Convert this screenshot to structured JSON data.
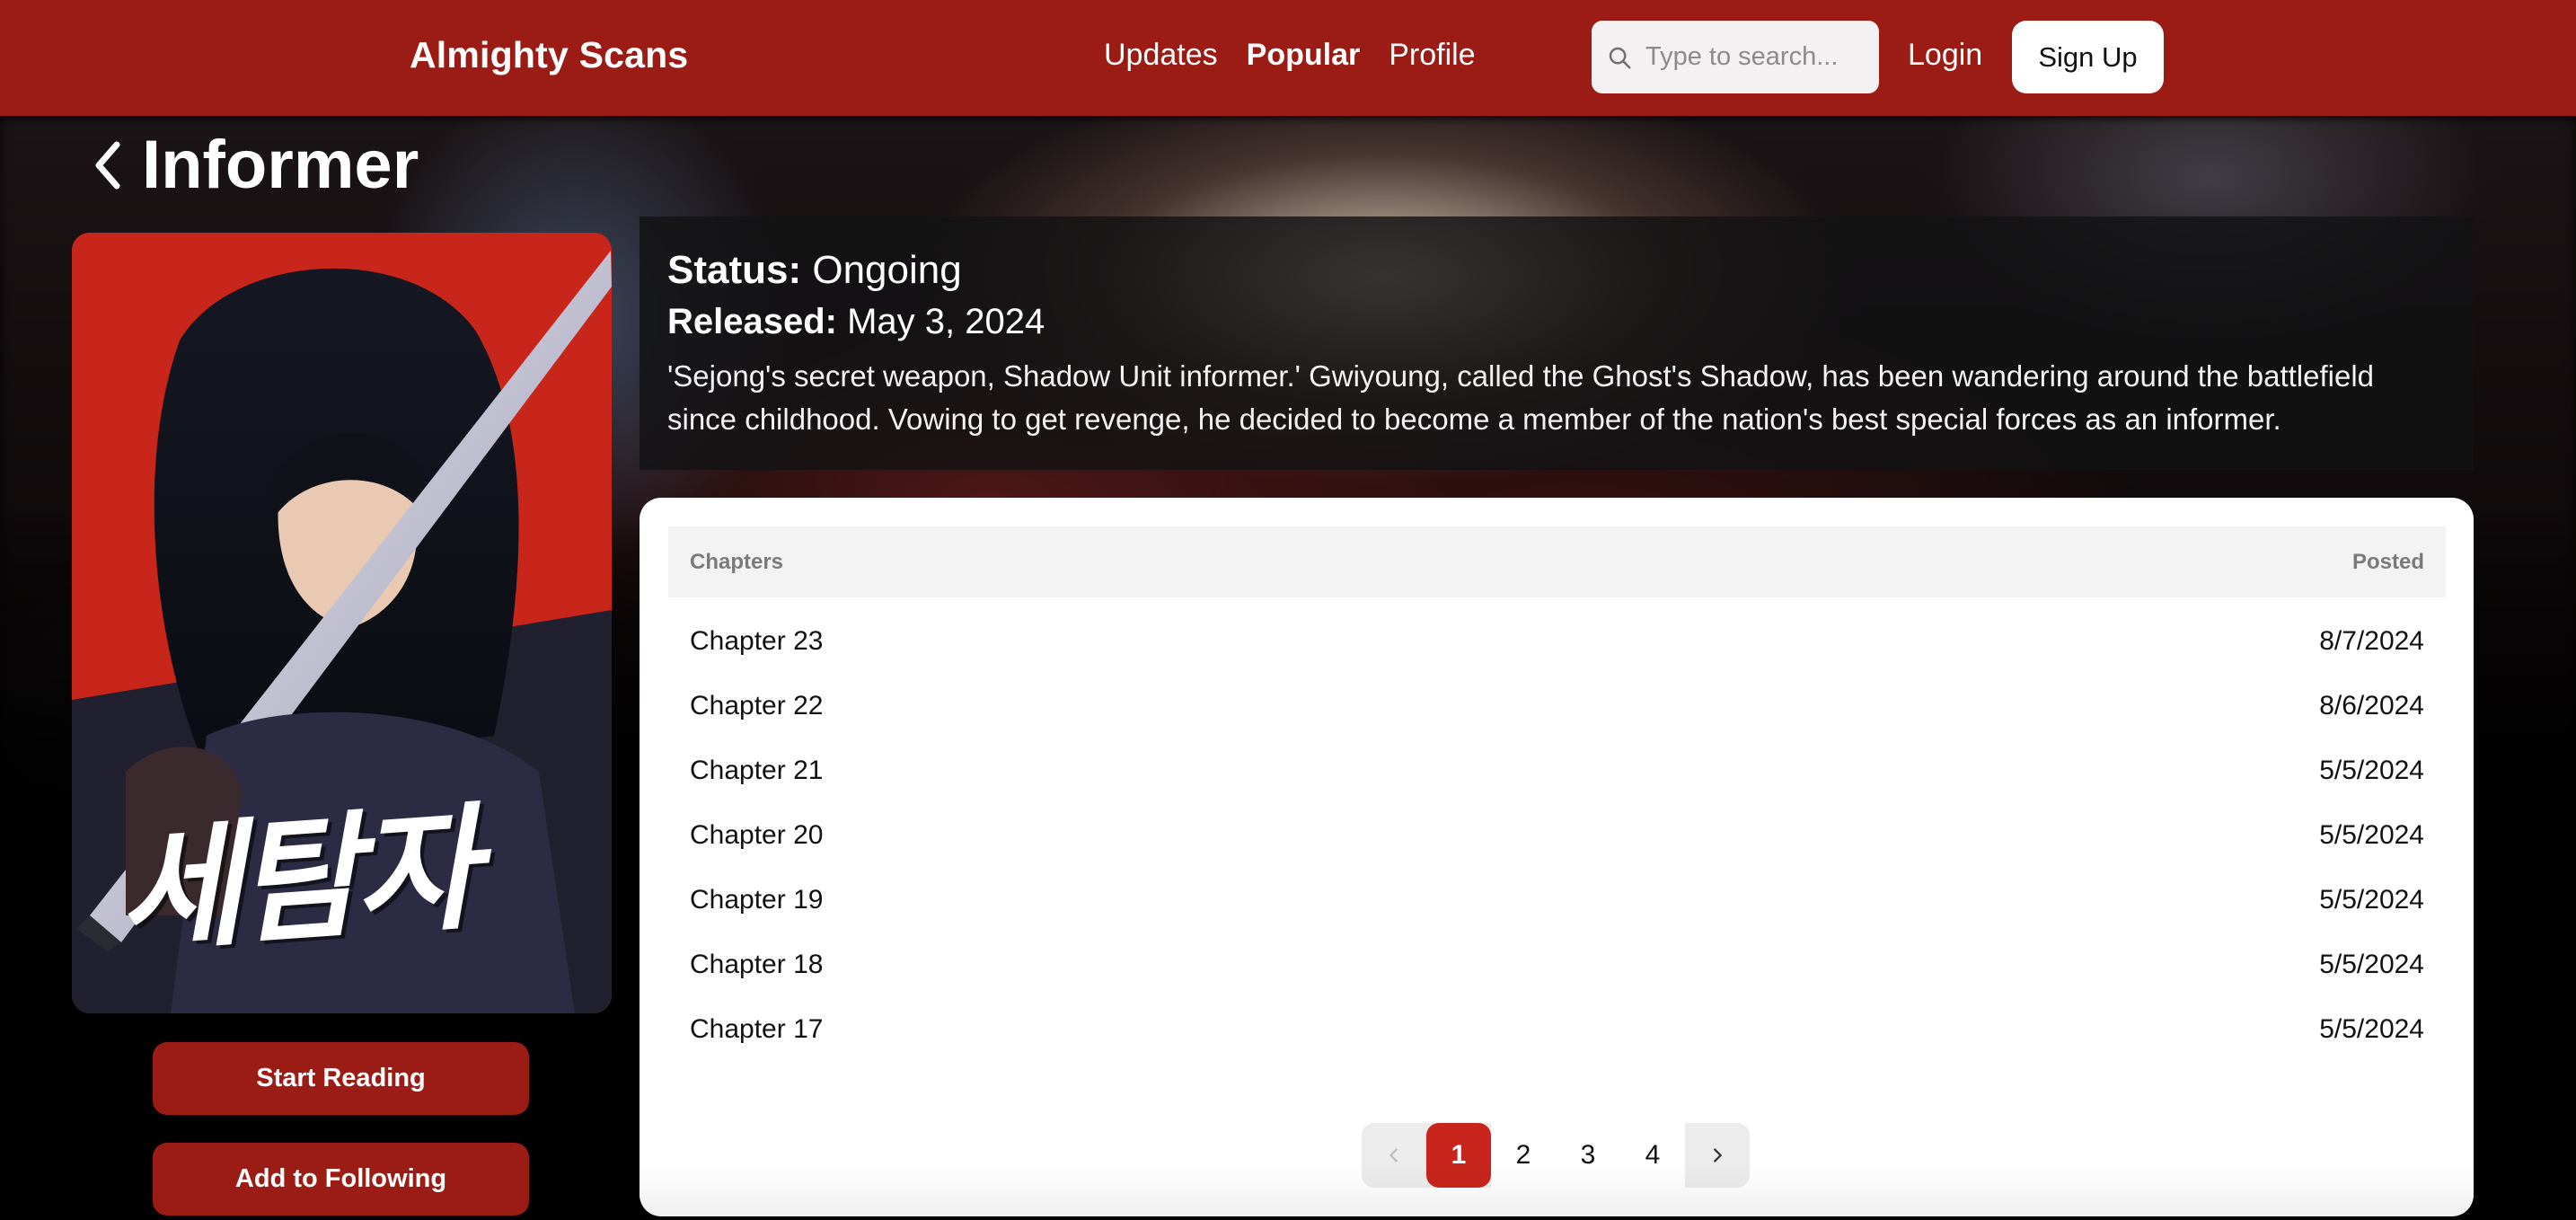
{
  "header": {
    "brand": "Almighty Scans",
    "nav": [
      {
        "label": "Updates",
        "active": false
      },
      {
        "label": "Popular",
        "active": true
      },
      {
        "label": "Profile",
        "active": false
      }
    ],
    "search_placeholder": "Type to search...",
    "login_label": "Login",
    "signup_label": "Sign Up",
    "accent_color": "#9b1b15"
  },
  "series": {
    "title": "Informer",
    "cover_text": "세탐자",
    "status_label": "Status:",
    "status_value": "Ongoing",
    "released_label": "Released:",
    "released_value": "May 3, 2024",
    "description": "'Sejong's secret weapon, Shadow Unit informer.' Gwiyoung, called the Ghost's Shadow, has been wandering around the battlefield since childhood. Vowing to get revenge, he decided to become a member of the nation's best special forces as an informer."
  },
  "actions": {
    "start_reading": "Start Reading",
    "add_following": "Add to Following"
  },
  "chapters": {
    "col_chapters": "Chapters",
    "col_posted": "Posted",
    "rows": [
      {
        "name": "Chapter 23",
        "date": "8/7/2024"
      },
      {
        "name": "Chapter 22",
        "date": "8/6/2024"
      },
      {
        "name": "Chapter 21",
        "date": "5/5/2024"
      },
      {
        "name": "Chapter 20",
        "date": "5/5/2024"
      },
      {
        "name": "Chapter 19",
        "date": "5/5/2024"
      },
      {
        "name": "Chapter 18",
        "date": "5/5/2024"
      },
      {
        "name": "Chapter 17",
        "date": "5/5/2024"
      }
    ]
  },
  "pagination": {
    "pages": [
      "1",
      "2",
      "3",
      "4"
    ],
    "current": "1",
    "active_color": "#c8251c"
  }
}
